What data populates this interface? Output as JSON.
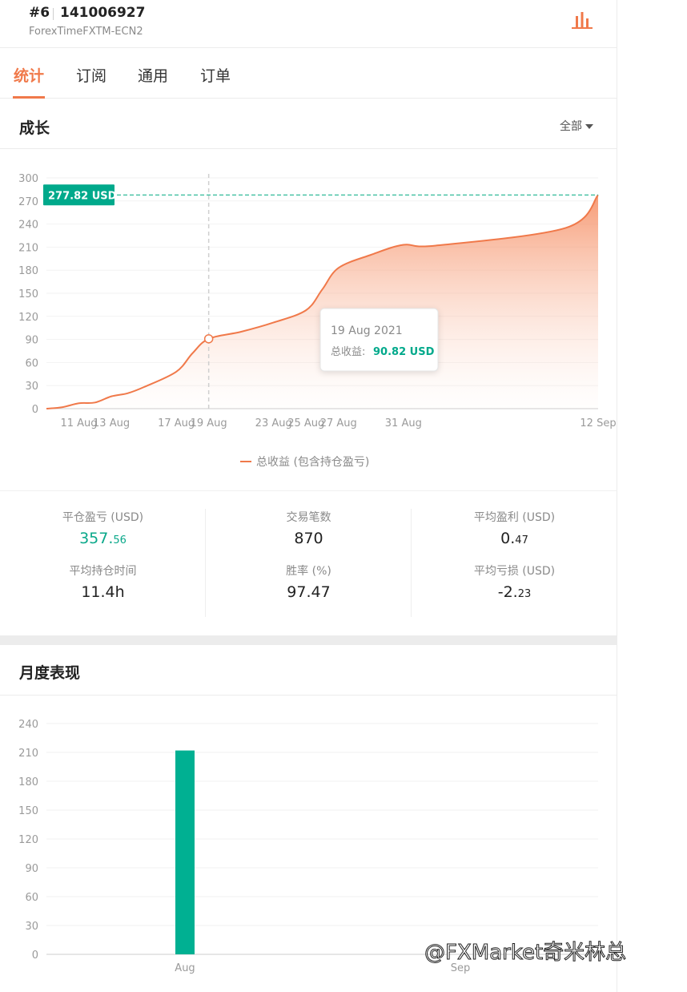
{
  "header": {
    "rank": "#6",
    "account": "141006927",
    "server": "ForexTimeFXTM-ECN2",
    "stats_icon": "bar-chart-icon"
  },
  "tabs": [
    {
      "label": "统计",
      "active": true
    },
    {
      "label": "订阅",
      "active": false
    },
    {
      "label": "通用",
      "active": false
    },
    {
      "label": "订单",
      "active": false
    }
  ],
  "growth": {
    "title": "成长",
    "range_label": "全部",
    "current_value_label": "277.82 USD",
    "tooltip": {
      "date": "19 Aug 2021",
      "label": "总收益:",
      "value": "90.82 USD"
    },
    "legend": "总收益 (包含持仓盈亏)"
  },
  "chart_data": [
    {
      "type": "area",
      "title": "成长",
      "ylim": [
        0,
        300
      ],
      "yticks": [
        "300",
        "270",
        "240",
        "210",
        "180",
        "150",
        "120",
        "90",
        "60",
        "30",
        "0"
      ],
      "xtick_labels": [
        "11 Aug",
        "13 Aug",
        "17 Aug",
        "19 Aug",
        "23 Aug",
        "25 Aug",
        "27 Aug",
        "31 Aug",
        "12 Sep"
      ],
      "series": [
        {
          "name": "总收益 (包含持仓盈亏)",
          "color": "#f0794a",
          "points": [
            [
              "9 Aug",
              0
            ],
            [
              "10 Aug",
              2
            ],
            [
              "11 Aug",
              7
            ],
            [
              "12 Aug",
              8
            ],
            [
              "13 Aug",
              16
            ],
            [
              "14 Aug",
              20
            ],
            [
              "15 Aug",
              28
            ],
            [
              "17 Aug",
              48
            ],
            [
              "18 Aug",
              72
            ],
            [
              "19 Aug",
              90.82
            ],
            [
              "21 Aug",
              100
            ],
            [
              "23 Aug",
              112
            ],
            [
              "25 Aug",
              128
            ],
            [
              "26 Aug",
              155
            ],
            [
              "27 Aug",
              183
            ],
            [
              "29 Aug",
              200
            ],
            [
              "31 Aug",
              213
            ],
            [
              "2 Sep",
              212
            ],
            [
              "10 Sep",
              235
            ],
            [
              "12 Sep",
              277.82
            ]
          ]
        }
      ]
    },
    {
      "type": "bar",
      "title": "月度表现",
      "categories": [
        "Aug",
        "Sep"
      ],
      "values": [
        212,
        0
      ],
      "ylim": [
        0,
        240
      ],
      "yticks": [
        "240",
        "210",
        "180",
        "150",
        "120",
        "90",
        "60",
        "30",
        "0"
      ],
      "color": "#00b092"
    }
  ],
  "stats": {
    "closed_pnl": {
      "label": "平仓盈亏 (USD)",
      "int": "357.",
      "frac": "56"
    },
    "trades": {
      "label": "交易笔数",
      "value": "870"
    },
    "avg_profit": {
      "label": "平均盈利 (USD)",
      "int": "0.",
      "frac": "47"
    },
    "avg_hold": {
      "label": "平均持仓时间",
      "value": "11.4h"
    },
    "win_rate": {
      "label": "胜率 (%)",
      "value": "97.47"
    },
    "avg_loss": {
      "label": "平均亏损 (USD)",
      "int": "-2.",
      "frac": "23"
    }
  },
  "monthly": {
    "title": "月度表现"
  },
  "watermark": "@FXMarket奇米林总",
  "colors": {
    "accent": "#f0794a",
    "green": "#00b092",
    "dashed": "#1bb38f"
  }
}
